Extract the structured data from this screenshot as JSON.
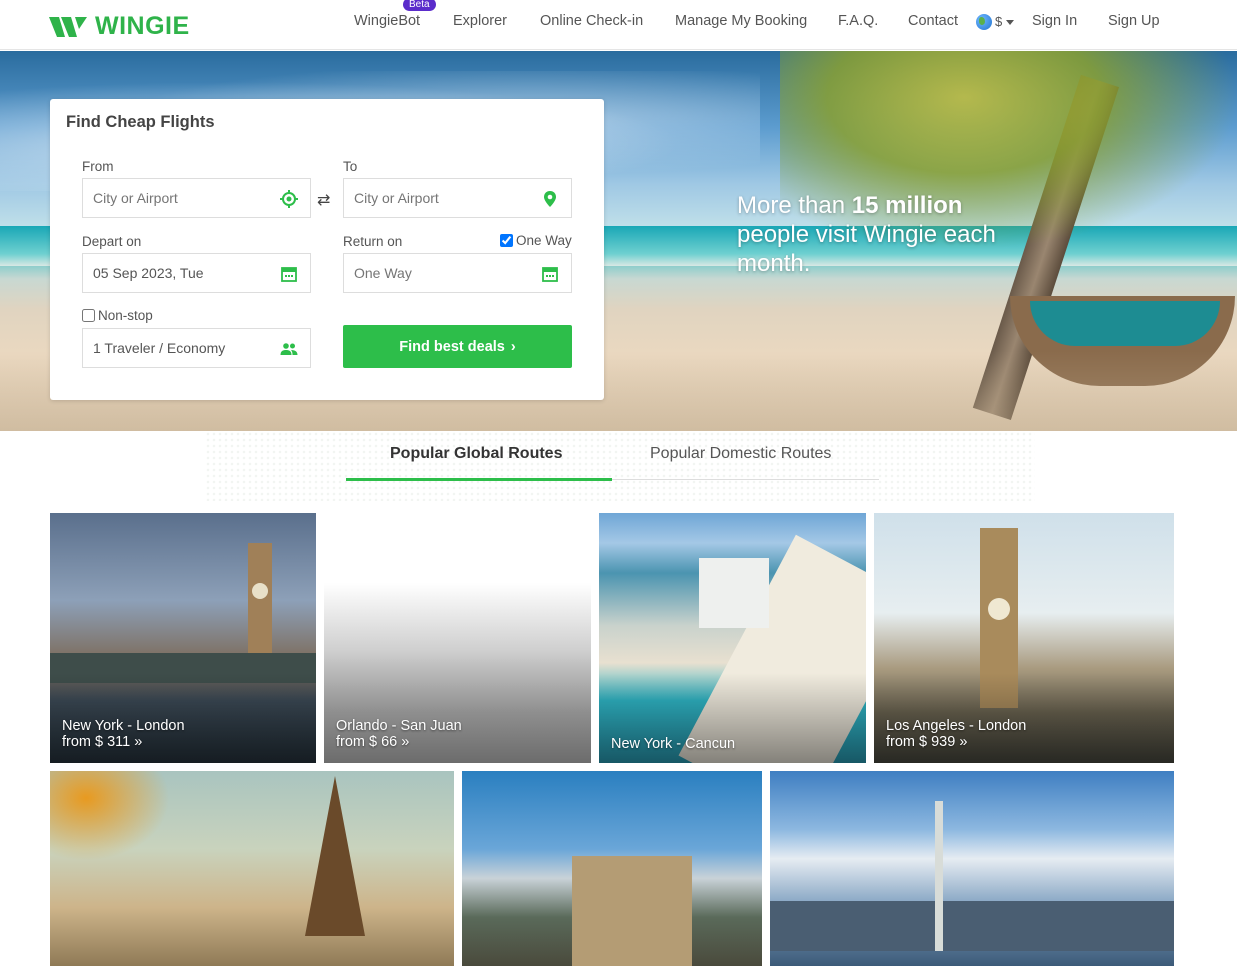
{
  "header": {
    "brand": "WINGIE",
    "nav": [
      {
        "label": "WingieBot",
        "badge": "Beta"
      },
      {
        "label": "Explorer"
      },
      {
        "label": "Online Check-in"
      },
      {
        "label": "Manage My Booking"
      },
      {
        "label": "F.A.Q."
      },
      {
        "label": "Contact"
      }
    ],
    "currency": "$",
    "sign_in": "Sign In",
    "sign_up": "Sign Up"
  },
  "hero": {
    "tagline_pre": "More than ",
    "tagline_bold": "15 million",
    "tagline_post": " people visit Wingie each month."
  },
  "search": {
    "title": "Find Cheap Flights",
    "from_label": "From",
    "from_placeholder": "City or Airport",
    "to_label": "To",
    "to_placeholder": "City or Airport",
    "depart_label": "Depart on",
    "depart_value": "05 Sep 2023, Tue",
    "return_label": "Return on",
    "return_placeholder": "One Way",
    "one_way_label": "One Way",
    "one_way_checked": true,
    "nonstop_label": "Non-stop",
    "nonstop_checked": false,
    "travelers_value": "1 Traveler / Economy",
    "find_button": "Find best deals"
  },
  "tabs": [
    {
      "label": "Popular Global Routes",
      "active": true
    },
    {
      "label": "Popular Domestic Routes",
      "active": false
    }
  ],
  "routes": [
    {
      "route": "New York - London",
      "price": "from $ 311"
    },
    {
      "route": "Orlando - San Juan",
      "price": "from $ 66"
    },
    {
      "route": "New York - Cancun",
      "price": ""
    },
    {
      "route": "Los Angeles - London",
      "price": "from $ 939"
    }
  ],
  "colors": {
    "brand_green": "#2fb34a",
    "button_green": "#2dbe4a",
    "beta_purple": "#5b2ccb"
  }
}
